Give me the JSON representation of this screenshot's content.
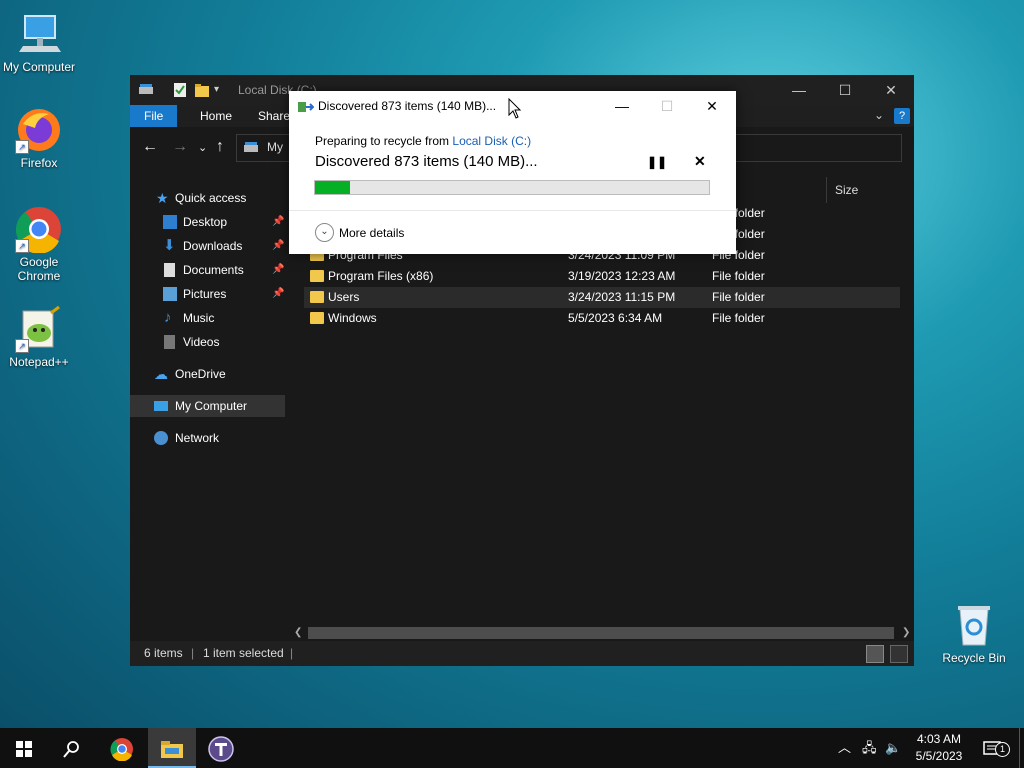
{
  "desktop": {
    "icons": [
      {
        "label": "My Computer"
      },
      {
        "label": "Firefox"
      },
      {
        "label": "Google Chrome"
      },
      {
        "label": "Notepad++"
      },
      {
        "label": "Recycle Bin"
      }
    ]
  },
  "explorer": {
    "title": "Local Disk (C:)",
    "ribbon_tabs": [
      "File",
      "Home",
      "Share"
    ],
    "address_prefix": "My",
    "column_size": "Size",
    "nav": {
      "quick_access": "Quick access",
      "desktop": "Desktop",
      "downloads": "Downloads",
      "documents": "Documents",
      "pictures": "Pictures",
      "music": "Music",
      "videos": "Videos",
      "onedrive": "OneDrive",
      "my_computer": "My Computer",
      "network": "Network"
    },
    "rows": [
      {
        "name": "",
        "date": "",
        "type": "File folder"
      },
      {
        "name": "",
        "date": "",
        "type": "File folder"
      },
      {
        "name": "Program Files",
        "date": "3/24/2023 11:09 PM",
        "type": "File folder"
      },
      {
        "name": "Program Files (x86)",
        "date": "3/19/2023 12:23 AM",
        "type": "File folder"
      },
      {
        "name": "Users",
        "date": "3/24/2023 11:15 PM",
        "type": "File folder"
      },
      {
        "name": "Windows",
        "date": "5/5/2023 6:34 AM",
        "type": "File folder"
      }
    ],
    "status_items": "6 items",
    "status_selected": "1 item selected"
  },
  "dialog": {
    "title": "Discovered 873 items (140 MB)...",
    "prep_text": "Preparing to recycle from ",
    "prep_link": "Local Disk (C:)",
    "status": "Discovered 873 items (140 MB)...",
    "progress_percent": 9,
    "more_details": "More details"
  },
  "taskbar": {
    "time": "4:03 AM",
    "date": "5/5/2023",
    "notifications": "1"
  },
  "colors": {
    "accent": "#1979ca",
    "progress": "#06b025",
    "link": "#1a5fb4"
  }
}
